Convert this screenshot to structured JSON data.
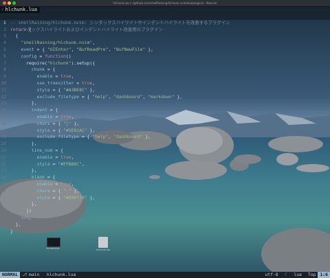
{
  "window": {
    "title": "hlchunk.lua (~/github.com/shellRaining/hlchunk.nvim/lua/plugins) - Neovim"
  },
  "tab": {
    "label": "hlchunk.lua",
    "icon": "lua-file-icon"
  },
  "line_numbers": {
    "current": "1",
    "relative": [
      "1",
      "2",
      "3",
      "4",
      "5",
      "6",
      "7",
      "8",
      "9",
      "10",
      "11",
      "12",
      "13",
      "14",
      "15",
      "16",
      "17",
      "18",
      "19",
      "20",
      "21",
      "22",
      "23",
      "24",
      "25",
      "26"
    ]
  },
  "code": {
    "line1": "-- シンタックスハイライトおよびインデントハイライト改善用のプラグイン",
    "lines": [
      "-- shellRaining/hlchunk.nvim: シンタックスハイライトやインデントハイライトを改善するプラグイン",
      "return {",
      "  {",
      "    \"shellRaining/hlchunk.nvim\",",
      "    event = { \"UIEnter\", \"BufReadPre\", \"BufNewFile\" },",
      "    config = function()",
      "      require(\"hlchunk\").setup({",
      "        chunk = {",
      "          enable = true,",
      "          use_treesitter = true,",
      "          style = { \"#A3BE8C\" },",
      "          exclude_filetype = { \"help\", \"dashboard\", \"markdown\" },",
      "        },",
      "        indent = {",
      "          enable = true,",
      "          chars = { \"│\" },",
      "          style = { \"#5E81AC\" },",
      "          exclude_filetype = { \"help\", \"dashboard\" },",
      "        },",
      "        line_num = {",
      "          enable = true,",
      "          style = \"#FFB86C\",",
      "        },",
      "        blank = {",
      "          enable = true,",
      "          chars = { \" \" },",
      "          style = { \"#D08770\" },",
      "        },",
      "      })",
      "    end,",
      "  },",
      "}"
    ]
  },
  "statusline": {
    "mode": "NORMAL",
    "branch": "main",
    "file": "hlchunk.lua",
    "encoding": "utf-8",
    "filetype": "lua",
    "percent": "Top",
    "position": "1:6"
  },
  "desktop": {
    "icons": [
      {
        "label": "Screenshot"
      },
      {
        "label": "hlchunk.lua"
      }
    ]
  },
  "colors": {
    "keyword": "#b48ead",
    "string": "#a3be8c",
    "field": "#88c0d0",
    "punct": "#d8dee9",
    "comment": "#7b8a96",
    "boolean": "#d08770",
    "func": "#88c0d0"
  }
}
